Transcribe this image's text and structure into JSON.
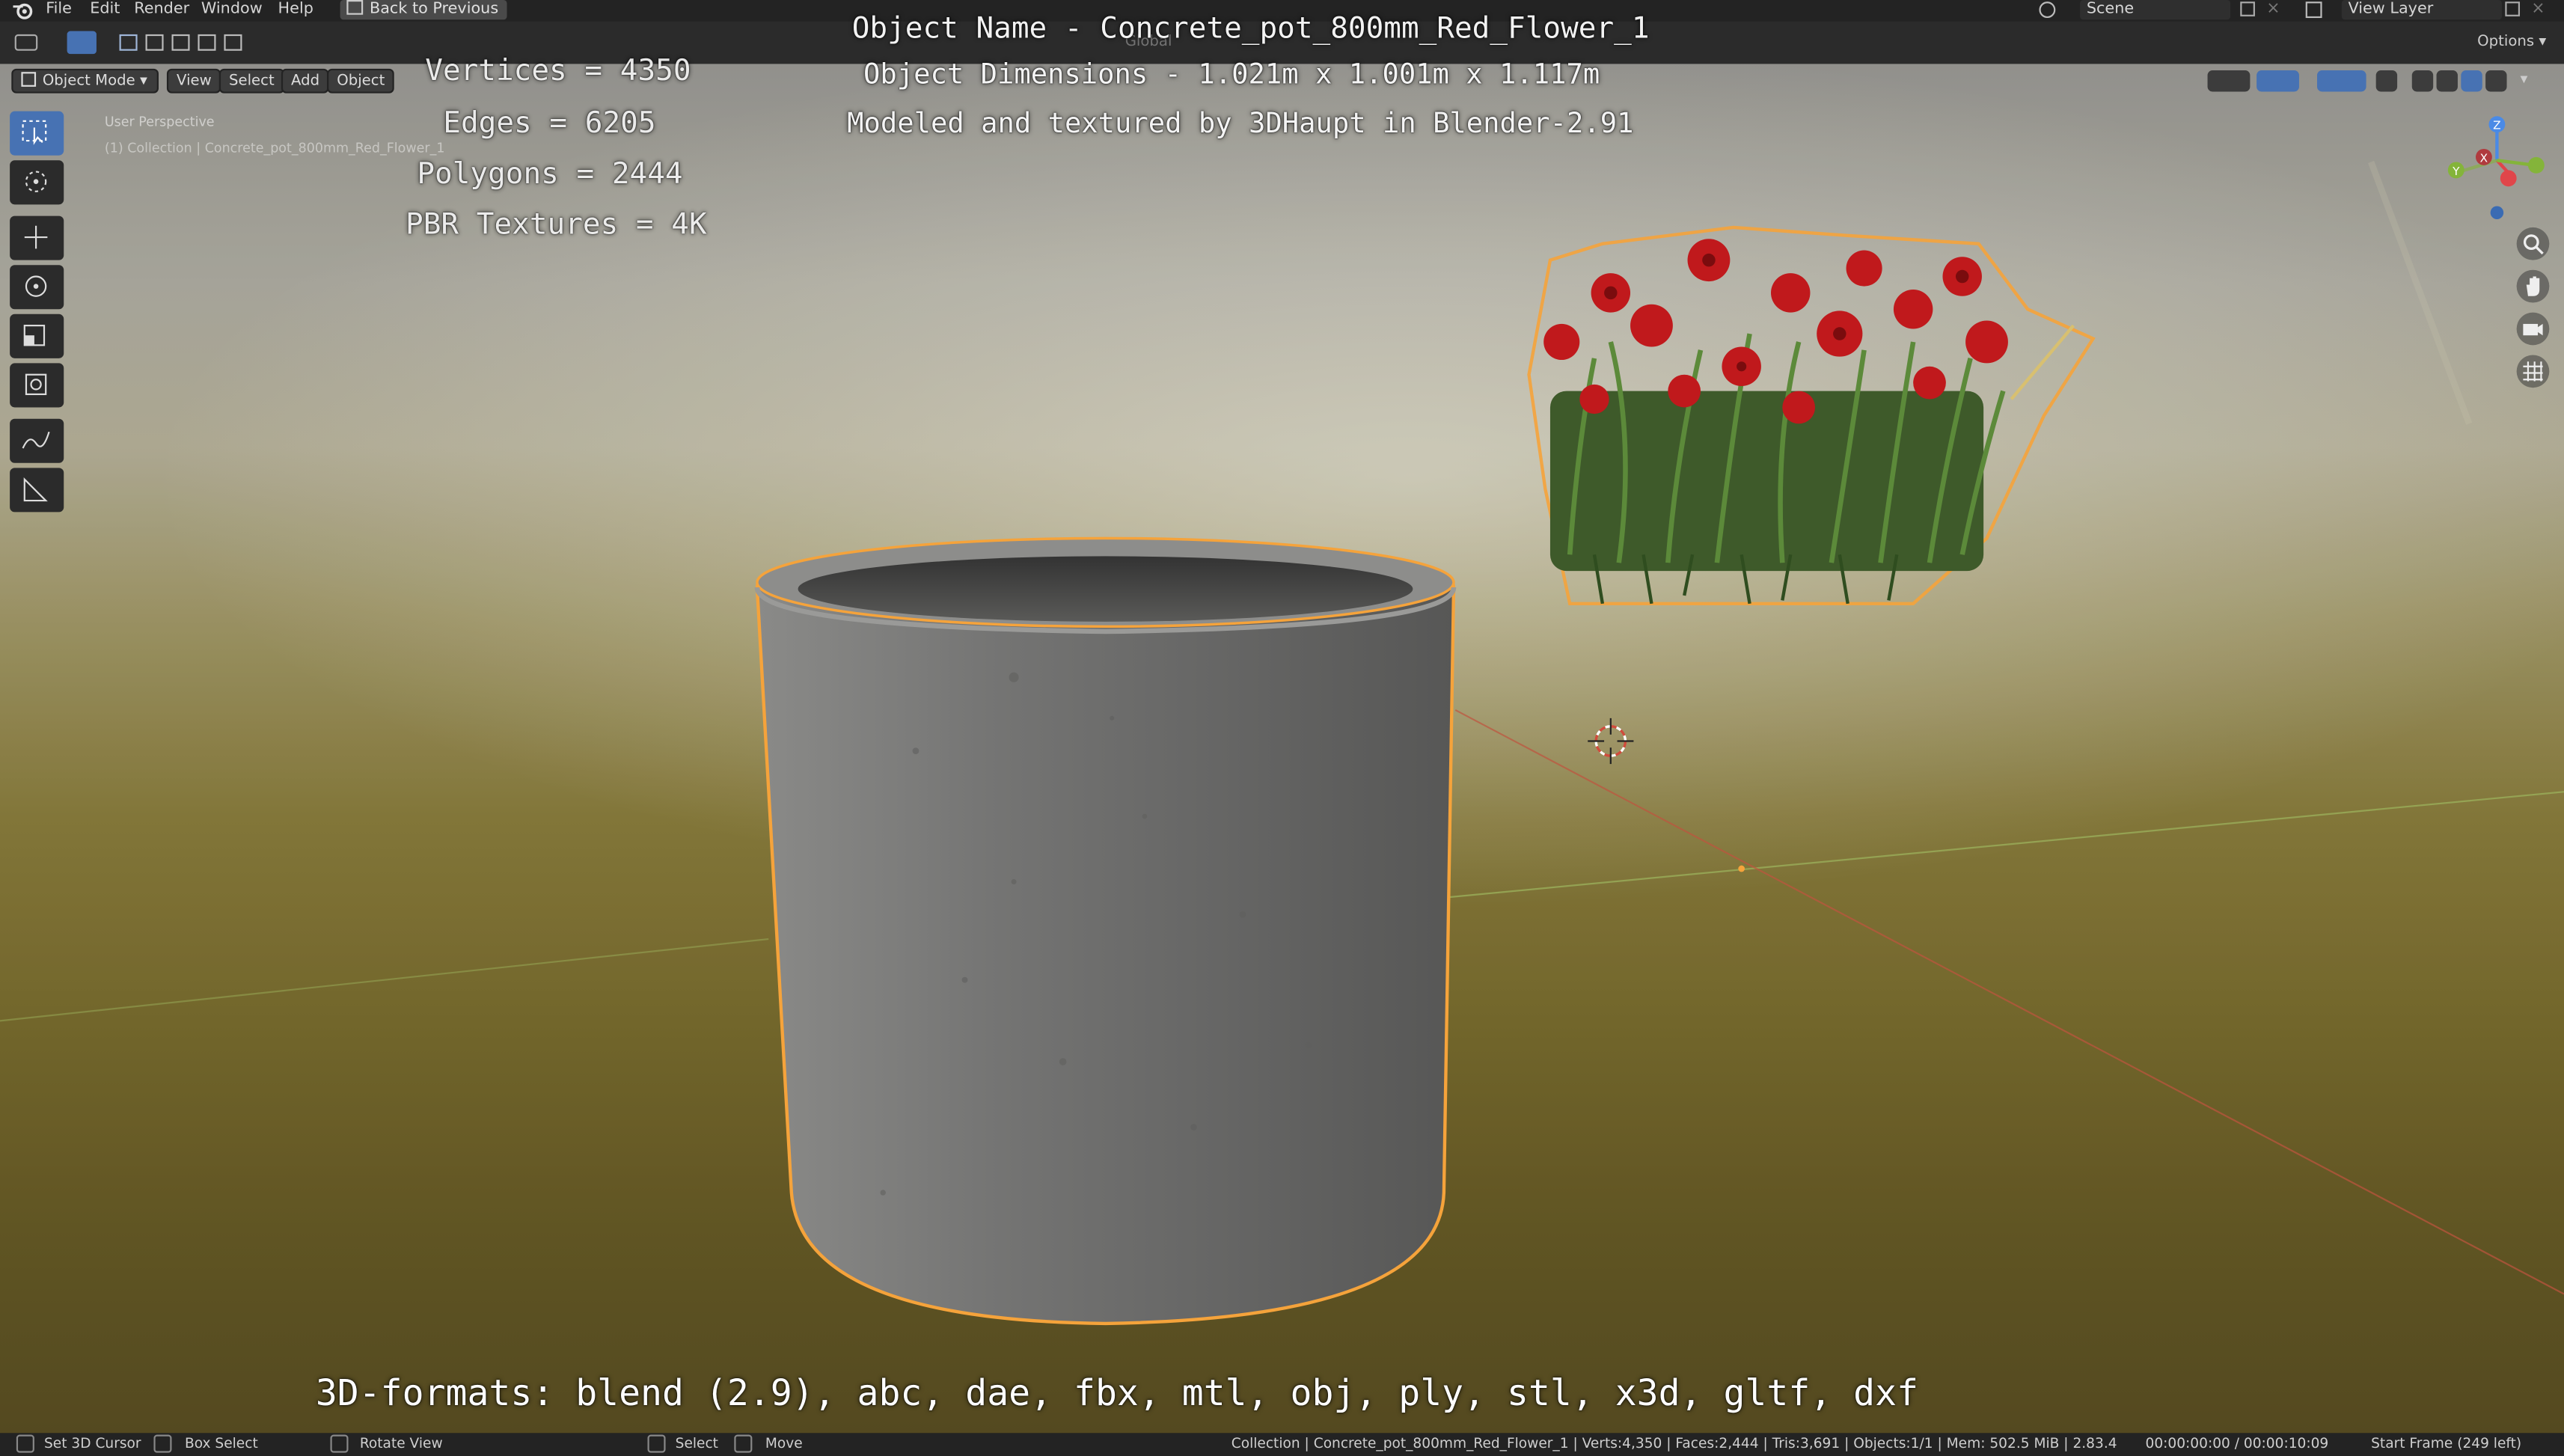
{
  "menu": {
    "items": [
      "File",
      "Edit",
      "Render",
      "Window",
      "Help"
    ],
    "back_button": "Back to Previous",
    "scene_label": "Scene",
    "view_layer_label": "View Layer"
  },
  "header": {
    "mode": "Object Mode",
    "menus": [
      "View",
      "Select",
      "Add",
      "Object"
    ],
    "transform_orientation": "Global",
    "options_label": "Options"
  },
  "viewport": {
    "perspective_label": "User Perspective",
    "collection_label": "(1) Collection | Concrete_pot_800mm_Red_Flower_1"
  },
  "overlay": {
    "object_name": "Object Name - Concrete_pot_800mm_Red_Flower_1",
    "dimensions": "Object Dimensions -  1.021m x 1.001m x 1.117m",
    "credit": "Modeled and textured by 3DHaupt in Blender-2.91",
    "vertices": "Vertices = 4350",
    "edges": "Edges = 6205",
    "polygons": "Polygons = 2444",
    "textures": "PBR Textures = 4K",
    "formats": "3D-formats: blend (2.9), abc, dae, fbx, mtl, obj, ply, stl, x3d, gltf, dxf"
  },
  "gizmo": {
    "x": "X",
    "y": "Y",
    "z": "Z"
  },
  "statusbar": {
    "set_cursor": "Set 3D Cursor",
    "box_select": "Box Select",
    "rotate_view": "Rotate View",
    "select": "Select",
    "move": "Move",
    "stats": "Collection | Concrete_pot_800mm_Red_Flower_1 | Verts:4,350 | Faces:2,444 | Tris:3,691 | Objects:1/1 | Mem: 502.5 MiB | 2.83.4",
    "time": "00:00:00:00 / 00:00:10:09",
    "start_frame": "Start Frame (249 left)"
  },
  "colors": {
    "accent": "#4772b3",
    "selection_outline": "#f5a33b",
    "axis_x": "#e0464a",
    "axis_y": "#84b43a",
    "axis_z": "#4a8ae6"
  }
}
